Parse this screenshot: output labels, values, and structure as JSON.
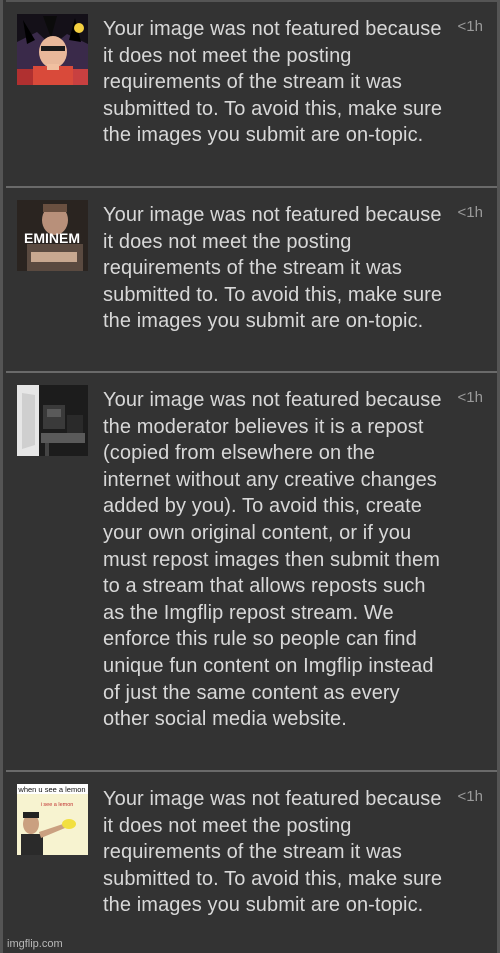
{
  "notifications": [
    {
      "message": "Your image was not featured because it does not meet the posting requirements of the stream it was submitted to. To avoid this, make sure the images you submit are on-topic.",
      "time": "<1h",
      "thumbnail": "anime-character-thumbnail"
    },
    {
      "message": "Your image was not featured because it does not meet the posting requirements of the stream it was submitted to. To avoid this, make sure the images you submit are on-topic.",
      "time": "<1h",
      "thumbnail": "eminem-thumbnail",
      "thumbnail_text": "EMINEM"
    },
    {
      "message": "Your image was not featured because the moderator believes it is a repost (copied from elsewhere on the internet without any creative changes added by you). To avoid this, create your own original content, or if you must repost images then submit them to a stream that allows reposts such as the Imgflip repost stream. We enforce this rule so people can find unique fun content on Imgflip instead of just the same content as every other social media website.",
      "time": "<1h",
      "thumbnail": "monochrome-room-thumbnail"
    },
    {
      "message": "Your image was not featured because it does not meet the posting requirements of the stream it was submitted to. To avoid this, make sure the images you submit are on-topic.",
      "time": "<1h",
      "thumbnail": "lemon-meme-thumbnail",
      "thumbnail_caption_top": "when u see a lemon",
      "thumbnail_caption_inner": "i see a lemon"
    }
  ],
  "watermark": "imgflip.com"
}
